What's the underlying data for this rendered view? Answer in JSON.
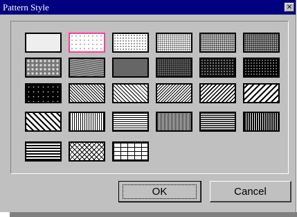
{
  "window": {
    "title": "Pattern Style",
    "close_glyph": "×"
  },
  "colors": {
    "titlebar": "#000080",
    "dialog_face": "#c0c0c0",
    "selection": "#ff3c96"
  },
  "patterns": [
    {
      "pattern": "solid-light"
    },
    {
      "pattern": "dots-sparse",
      "selected": true
    },
    {
      "pattern": "dots-light"
    },
    {
      "pattern": "dots-medium-light"
    },
    {
      "pattern": "dots-medium"
    },
    {
      "pattern": "dots-medium-dark"
    },
    {
      "pattern": "gray-spots"
    },
    {
      "pattern": "gray-wave"
    },
    {
      "pattern": "dark-checker"
    },
    {
      "pattern": "dark-stipple"
    },
    {
      "pattern": "dark-grid-dots"
    },
    {
      "pattern": "black-fine-dots"
    },
    {
      "pattern": "black-sparse-dots"
    },
    {
      "pattern": "diagonal-fine"
    },
    {
      "pattern": "diagonal-up-medium"
    },
    {
      "pattern": "diagonal-down-fine"
    },
    {
      "pattern": "diagonal-down-medium"
    },
    {
      "pattern": "diagonal-down-wide"
    },
    {
      "pattern": "diagonal-up-wide"
    },
    {
      "pattern": "vertical-lines"
    },
    {
      "pattern": "horizontal-fine"
    },
    {
      "pattern": "vertical-dense"
    },
    {
      "pattern": "horizontal-medium"
    },
    {
      "pattern": "vertical-bold"
    },
    {
      "pattern": "horizontal-bold"
    },
    {
      "pattern": "crosshatch-diagonal"
    },
    {
      "pattern": "brick"
    }
  ],
  "buttons": {
    "ok": "OK",
    "cancel": "Cancel"
  }
}
